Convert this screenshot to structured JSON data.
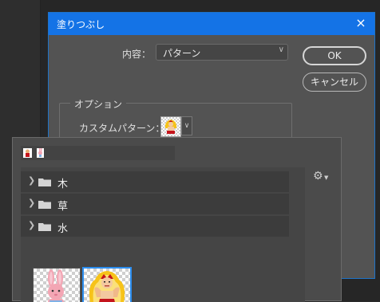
{
  "dialog": {
    "title": "塗りつぶし",
    "close_icon": "×",
    "content_label": "内容：",
    "content_value": "パターン",
    "ok_label": "OK",
    "cancel_label": "キャンセル",
    "options_legend": "オプション",
    "custom_pattern_label": "カスタムパターン："
  },
  "picker": {
    "folders": [
      {
        "name": "木"
      },
      {
        "name": "草"
      },
      {
        "name": "水"
      }
    ],
    "patterns": [
      {
        "icon": "rabbit-pattern"
      },
      {
        "icon": "muscle-man-pattern",
        "selected": true
      }
    ]
  },
  "colors": {
    "title_bar": "#1473e6",
    "selection": "#2c8ef0"
  }
}
